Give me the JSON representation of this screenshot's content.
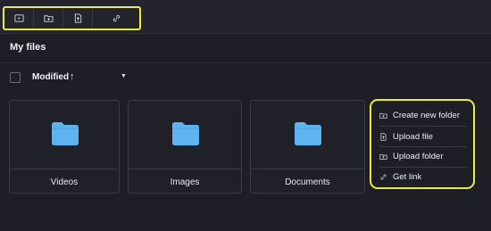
{
  "header": {
    "title": "My files"
  },
  "toolbar": {
    "buttons": [
      {
        "icon": "upload-video-icon"
      },
      {
        "icon": "new-folder-icon"
      },
      {
        "icon": "upload-file-icon"
      },
      {
        "icon": "link-icon"
      }
    ]
  },
  "sort": {
    "label": "Modified",
    "direction": "↑",
    "caret": "▼"
  },
  "folders": [
    {
      "name": "Videos"
    },
    {
      "name": "Images"
    },
    {
      "name": "Documents"
    }
  ],
  "context_menu": {
    "items": [
      {
        "label": "Create new folder",
        "icon": "new-folder-icon"
      },
      {
        "label": "Upload file",
        "icon": "upload-file-icon"
      },
      {
        "label": "Upload folder",
        "icon": "upload-folder-icon"
      },
      {
        "label": "Get link",
        "icon": "link-icon"
      }
    ]
  },
  "colors": {
    "highlight": "#ecec3c",
    "folder": "#5eb4f0",
    "background": "#1e1e26"
  }
}
